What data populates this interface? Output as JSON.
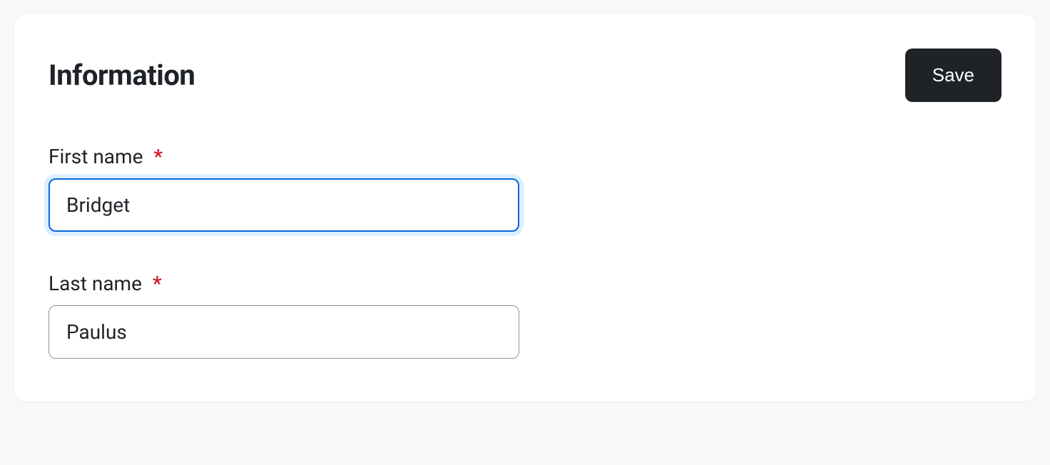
{
  "card": {
    "title": "Information",
    "save_label": "Save"
  },
  "form": {
    "first_name": {
      "label": "First name",
      "value": "Bridget",
      "required_marker": "*"
    },
    "last_name": {
      "label": "Last name",
      "value": "Paulus",
      "required_marker": "*"
    }
  }
}
